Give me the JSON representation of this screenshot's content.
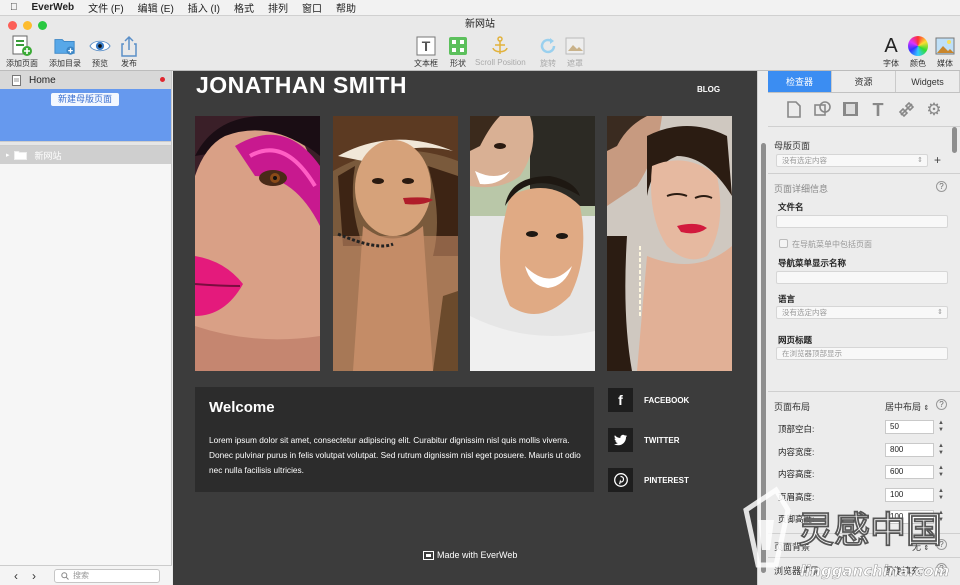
{
  "menubar": {
    "app_name": "EverWeb",
    "items": [
      "文件 (F)",
      "编辑 (E)",
      "插入 (I)",
      "格式",
      "排列",
      "窗口",
      "帮助"
    ]
  },
  "window": {
    "title": "新网站"
  },
  "toolbar": {
    "add_page": "添加页面",
    "add_folder": "添加目录",
    "preview": "预览",
    "publish": "发布",
    "textbox": "文本框",
    "shape": "形状",
    "scroll_position": "Scroll Position",
    "rotate": "旋转",
    "mask": "遮罩",
    "font": "字体",
    "color": "颜色",
    "media": "媒体"
  },
  "sidebar": {
    "home_label": "Home",
    "new_master_button": "新建母版页面",
    "site_label": "新网站",
    "search_placeholder": "搜索"
  },
  "canvas": {
    "site_title": "JONATHAN SMITH",
    "blog_link": "BLOG",
    "welcome_title": "Welcome",
    "welcome_body": "Lorem ipsum dolor sit amet, consectetur adipiscing elit. Curabitur dignissim nisl quis mollis viverra. Donec pulvinar purus in felis volutpat volutpat. Sed rutrum dignissim nisl eget posuere. Mauris ut odio nec nulla facilisis ultricies.",
    "social": [
      {
        "name": "FACEBOOK",
        "icon": "facebook-icon",
        "glyph": "f"
      },
      {
        "name": "TWITTER",
        "icon": "twitter-icon",
        "glyph": "t"
      },
      {
        "name": "PINTEREST",
        "icon": "pinterest-icon",
        "glyph": "p"
      }
    ],
    "made_with": "Made with EverWeb",
    "background_color": "#3c3c3c"
  },
  "inspector": {
    "tabs": [
      "检查器",
      "资源",
      "Widgets"
    ],
    "active_tab": "检查器",
    "accent_color": "#3b8df2",
    "master_page": "母版页面",
    "master_page_select": "没有选定内容",
    "page_details": "页面详细信息",
    "file_name": "文件名",
    "include_in_nav": "在导航菜单中包括页面",
    "nav_display_name": "导航菜单显示名称",
    "language": "语言",
    "language_select": "没有选定内容",
    "page_title_label": "网页标题",
    "page_title_placeholder": "在浏览器顶部显示",
    "page_layout": "页面布局",
    "page_layout_value": "居中布局",
    "top_spacing": "顶部空白:",
    "top_spacing_value": "50",
    "content_width": "内容宽度:",
    "content_width_value": "800",
    "content_height": "内容高度:",
    "content_height_value": "600",
    "header_height": "页眉高度:",
    "header_height_value": "100",
    "footer_height": "页脚高度:",
    "footer_height_value": "100",
    "page_background": "页面背景",
    "page_background_value": "无",
    "browser_background": "浏览器背景",
    "browser_background_value": "图像填充"
  },
  "watermark": {
    "text_cn": "灵感中国",
    "text_url": "lingganchina.com"
  }
}
